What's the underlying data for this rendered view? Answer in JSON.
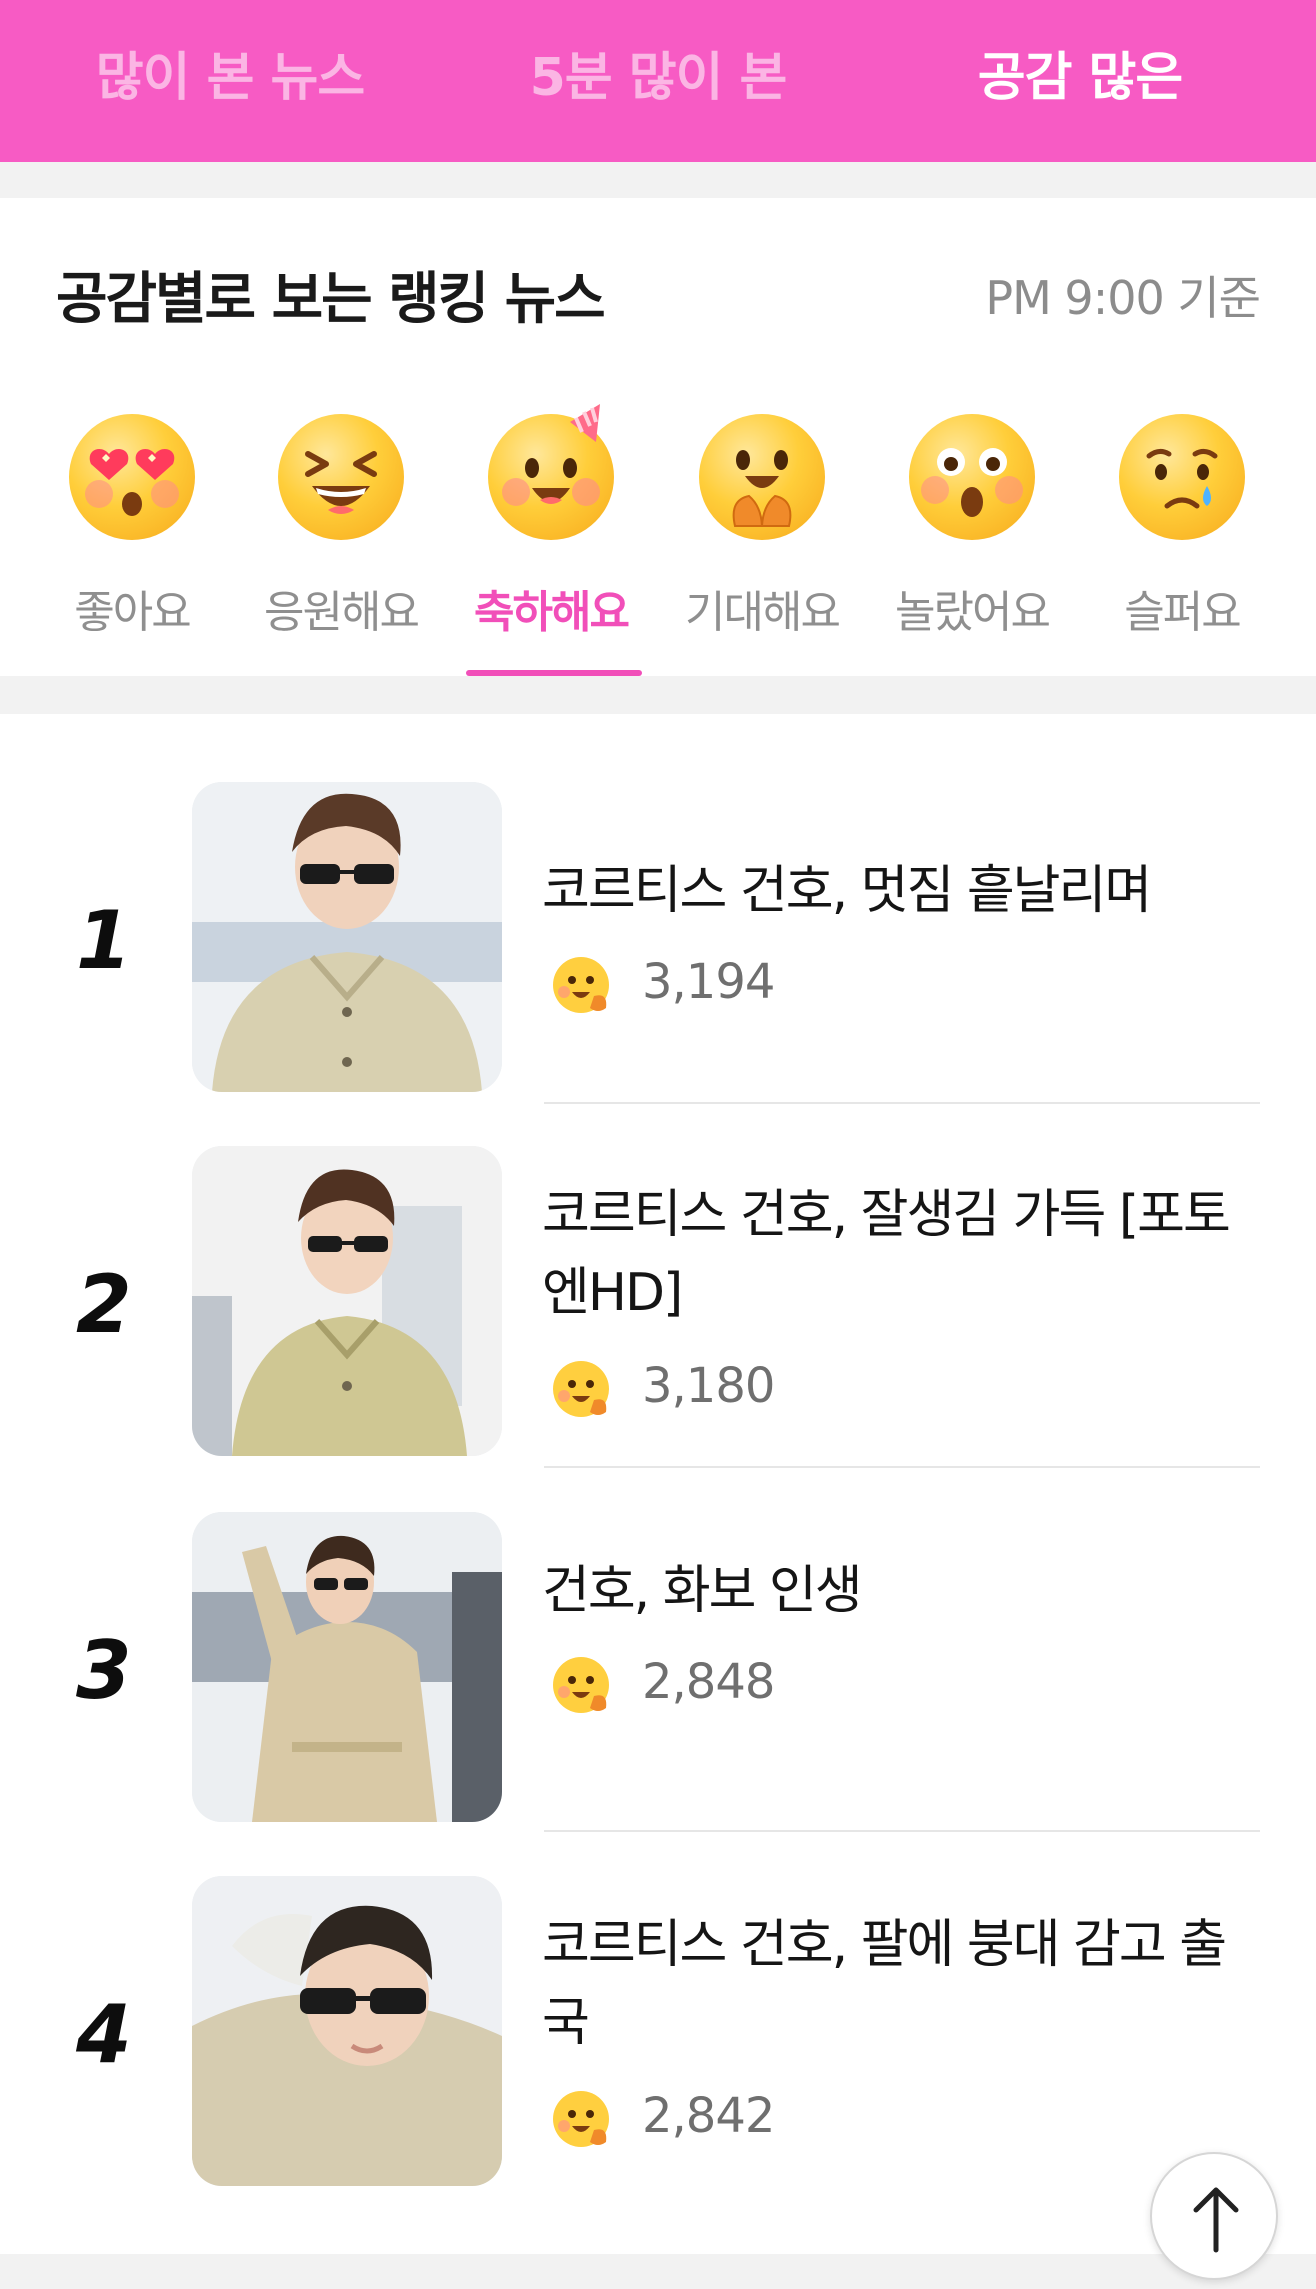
{
  "top_tabs": [
    "많이 본 뉴스",
    "5분 많이 본",
    "공감 많은"
  ],
  "section": {
    "title": "공감별로 보는 랭킹 뉴스",
    "basis": "PM 9:00 기준"
  },
  "emotions": [
    {
      "label": "좋아요",
      "icon": "heart-eyes-emoji-icon"
    },
    {
      "label": "응원해요",
      "icon": "laughing-emoji-icon"
    },
    {
      "label": "축하해요",
      "icon": "party-emoji-icon",
      "active": true
    },
    {
      "label": "기대해요",
      "icon": "hopeful-emoji-icon"
    },
    {
      "label": "놀랐어요",
      "icon": "surprised-emoji-icon"
    },
    {
      "label": "슬퍼요",
      "icon": "sad-emoji-icon"
    }
  ],
  "ranking": [
    {
      "rank": "1",
      "headline": "코르티스 건호, 멋짐 흩날리며",
      "count": "3,194"
    },
    {
      "rank": "2",
      "headline": "코르티스 건호, 잘생김 가득 [포토엔HD]",
      "count": "3,180"
    },
    {
      "rank": "3",
      "headline": "건호, 화보 인생",
      "count": "2,848"
    },
    {
      "rank": "4",
      "headline": "코르티스 건호, 팔에 붕대 감고 출국",
      "count": "2,842"
    }
  ],
  "colors": {
    "brand": "#f75bc4",
    "accent": "#f14fb9"
  },
  "scroll_top_icon": "arrow-up-icon"
}
